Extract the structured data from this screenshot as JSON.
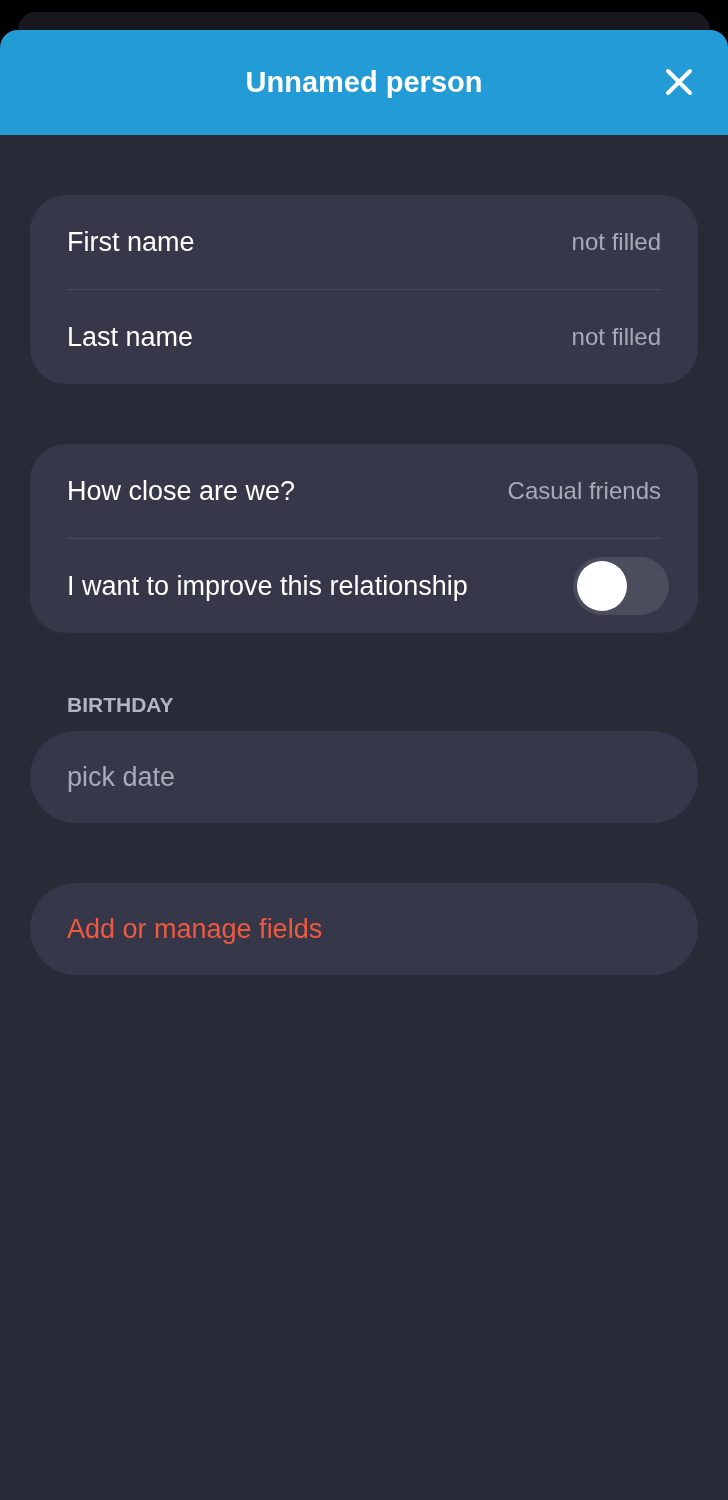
{
  "header": {
    "title": "Unnamed person"
  },
  "groups": [
    {
      "rows": [
        {
          "kind": "value",
          "label": "First name",
          "value": "not filled"
        },
        {
          "kind": "value",
          "label": "Last name",
          "value": "not filled"
        }
      ]
    },
    {
      "rows": [
        {
          "kind": "value",
          "label": "How close are we?",
          "value": "Casual friends"
        },
        {
          "kind": "toggle",
          "label": "I want to improve this relationship",
          "on": false
        }
      ]
    }
  ],
  "birthday": {
    "label": "BIRTHDAY",
    "placeholder": "pick date"
  },
  "action": {
    "label": "Add or manage fields"
  }
}
